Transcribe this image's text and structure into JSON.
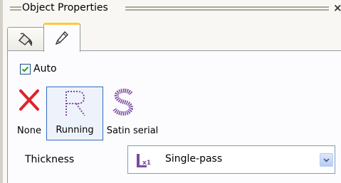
{
  "panel": {
    "title": "Object Properties",
    "close_glyph": "×",
    "tabs": [
      {
        "icon": "paint-bucket-icon",
        "active": false
      },
      {
        "icon": "pen-icon",
        "active": true
      }
    ]
  },
  "auto": {
    "label": "Auto",
    "checked": true
  },
  "styles": [
    {
      "label": "None",
      "icon": "red-x-icon",
      "selected": false
    },
    {
      "label": "Running",
      "icon": "running-stitch-r-icon",
      "selected": true
    },
    {
      "label": "Satin serial",
      "icon": "satin-s-icon",
      "selected": false
    }
  ],
  "thickness": {
    "label": "Thickness",
    "value": "Single-pass",
    "value_icon": "single-pass-icon",
    "value_icon_text": "x1"
  },
  "colors": {
    "accent_tab": "#ffc83c",
    "selected_border": "#316ac5",
    "stitch_purple": "#7a4aa0",
    "none_red": "#e0222a"
  }
}
